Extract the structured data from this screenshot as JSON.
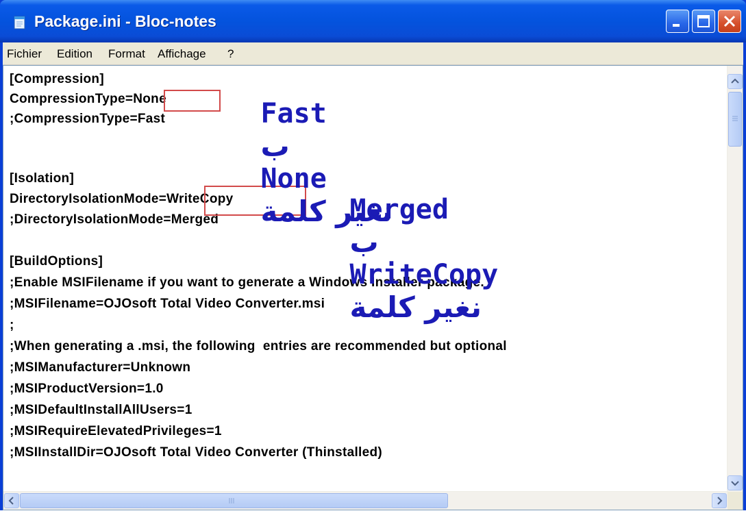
{
  "window": {
    "title": "Package.ini - Bloc-notes"
  },
  "menu": {
    "items": [
      "Fichier",
      "Edition",
      "Format",
      "Affichage",
      "?"
    ]
  },
  "document": {
    "lines": [
      "[Compression]",
      "CompressionType=None",
      ";CompressionType=Fast",
      "",
      "[Isolation]",
      "DirectoryIsolationMode=WriteCopy",
      ";DirectoryIsolationMode=Merged",
      "",
      "[BuildOptions]",
      ";Enable MSIFilename if you want to generate a Windows Installer package.",
      ";MSIFilename=OJOsoft Total Video Converter.msi",
      ";",
      ";When generating a .msi, the following  entries are recommended but optional",
      ";MSIManufacturer=Unknown",
      ";MSIProductVersion=1.0",
      ";MSIDefaultInstallAllUsers=1",
      ";MSIRequireElevatedPrivileges=1",
      ";MSIInstallDir=OJOsoft Total Video Converter (Thinstalled)"
    ]
  },
  "annotations": {
    "first": {
      "arabic": "نغير كلمة",
      "word_from": "None",
      "arabic_by": "ب",
      "word_to": "Fast"
    },
    "second": {
      "arabic": "نغير كلمة",
      "word_from": "WriteCopy",
      "arabic_by": "ب",
      "word_to": "Merged"
    }
  },
  "colors": {
    "annotation": "#1b1bb5",
    "highlight_box": "#d24a4a",
    "title_bar": "#0453dd"
  },
  "icons": [
    "notepad-icon",
    "minimize-icon",
    "maximize-icon",
    "close-icon",
    "scroll-up-icon",
    "scroll-down-icon",
    "scroll-left-icon",
    "scroll-right-icon"
  ]
}
